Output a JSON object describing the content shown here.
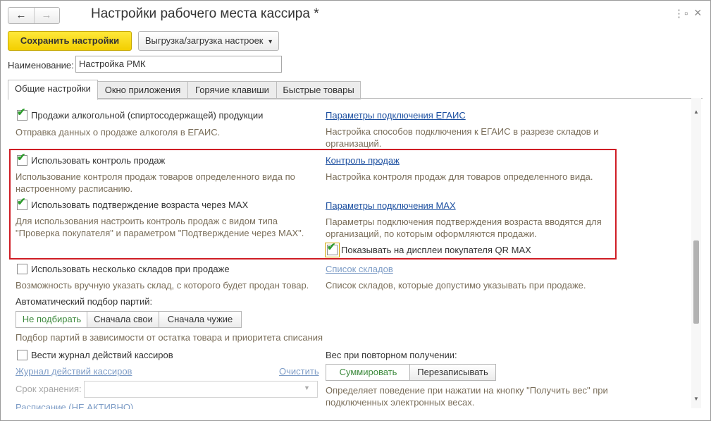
{
  "header": {
    "title": "Настройки рабочего места кассира *",
    "back_icon": "←",
    "forward_icon": "→",
    "menu_icon": "⋮",
    "maximize_icon": "▫",
    "close_icon": "×"
  },
  "toolbar": {
    "save_label": "Сохранить настройки",
    "export_label": "Выгрузка/загрузка настроек",
    "export_arrow": "▾"
  },
  "name_field": {
    "label": "Наименование:",
    "value": "Настройка РМК"
  },
  "tabs": [
    {
      "label": "Общие настройки",
      "active": true
    },
    {
      "label": "Окно приложения",
      "active": false
    },
    {
      "label": "Горячие клавиши",
      "active": false
    },
    {
      "label": "Быстрые товары",
      "active": false
    }
  ],
  "content": {
    "alcohol": {
      "label": "Продажи алкогольной (спиртосодержащей) продукции",
      "checked": true,
      "hint": "Отправка данных о продаже алкоголя в ЕГАИС.",
      "link": "Параметры подключения ЕГАИС",
      "link_hint": "Настройка способов подключения к ЕГАИС в разрезе складов и организаций."
    },
    "sales_control": {
      "label": "Использовать контроль продаж",
      "checked": true,
      "hint": "Использование контроля продаж товаров определенного вида по настроенному расписанию.",
      "link": "Контроль продаж",
      "link_hint": "Настройка контроля продаж для товаров определенного вида."
    },
    "age_max": {
      "label": "Использовать подтверждение возраста через MAX",
      "checked": true,
      "hint": "Для использования настроить контроль продаж с видом типа \"Проверка покупателя\" и параметром \"Подтверждение через MAX\".",
      "link": "Параметры подключения MAX",
      "link_hint": "Параметры подключения подтверждения возраста вводятся для организаций, по которым оформляются продажи.",
      "qr_label": "Показывать на дисплеи покупателя QR MAX",
      "qr_checked": true
    },
    "warehouses": {
      "label": "Использовать несколько складов при продаже",
      "checked": false,
      "hint": "Возможность вручную указать склад, с которого будет продан товар.",
      "link": "Список складов",
      "link_hint": "Список складов, которые допустимо указывать при продаже."
    },
    "batches": {
      "label": "Автоматический подбор партий:",
      "options": [
        "Не подбирать",
        "Сначала свои",
        "Сначала чужие"
      ],
      "selected": "Не подбирать",
      "hint": "Подбор партий в зависимости от остатка товара и приоритета списания"
    },
    "journal": {
      "label": "Вести журнал действий кассиров",
      "checked": false,
      "link": "Журнал действий кассиров",
      "clear_link": "Очистить",
      "storage_label": "Срок хранения:",
      "storage_value": "",
      "schedule_link": "Расписание (НЕ АКТИВНО)"
    },
    "weight": {
      "label": "Вес при повторном получении:",
      "options": [
        "Суммировать",
        "Перезаписывать"
      ],
      "selected": "Суммировать",
      "hint": "Определяет поведение при нажатии на кнопку \"Получить вес\" при подключенных электронных весах."
    }
  },
  "colors": {
    "accent_yellow": "#f3cf00",
    "highlight_red": "#cf1d25",
    "link_blue": "#1c4fa0",
    "hint_text": "#7a6e5a",
    "check_green": "#2e9c2e"
  }
}
